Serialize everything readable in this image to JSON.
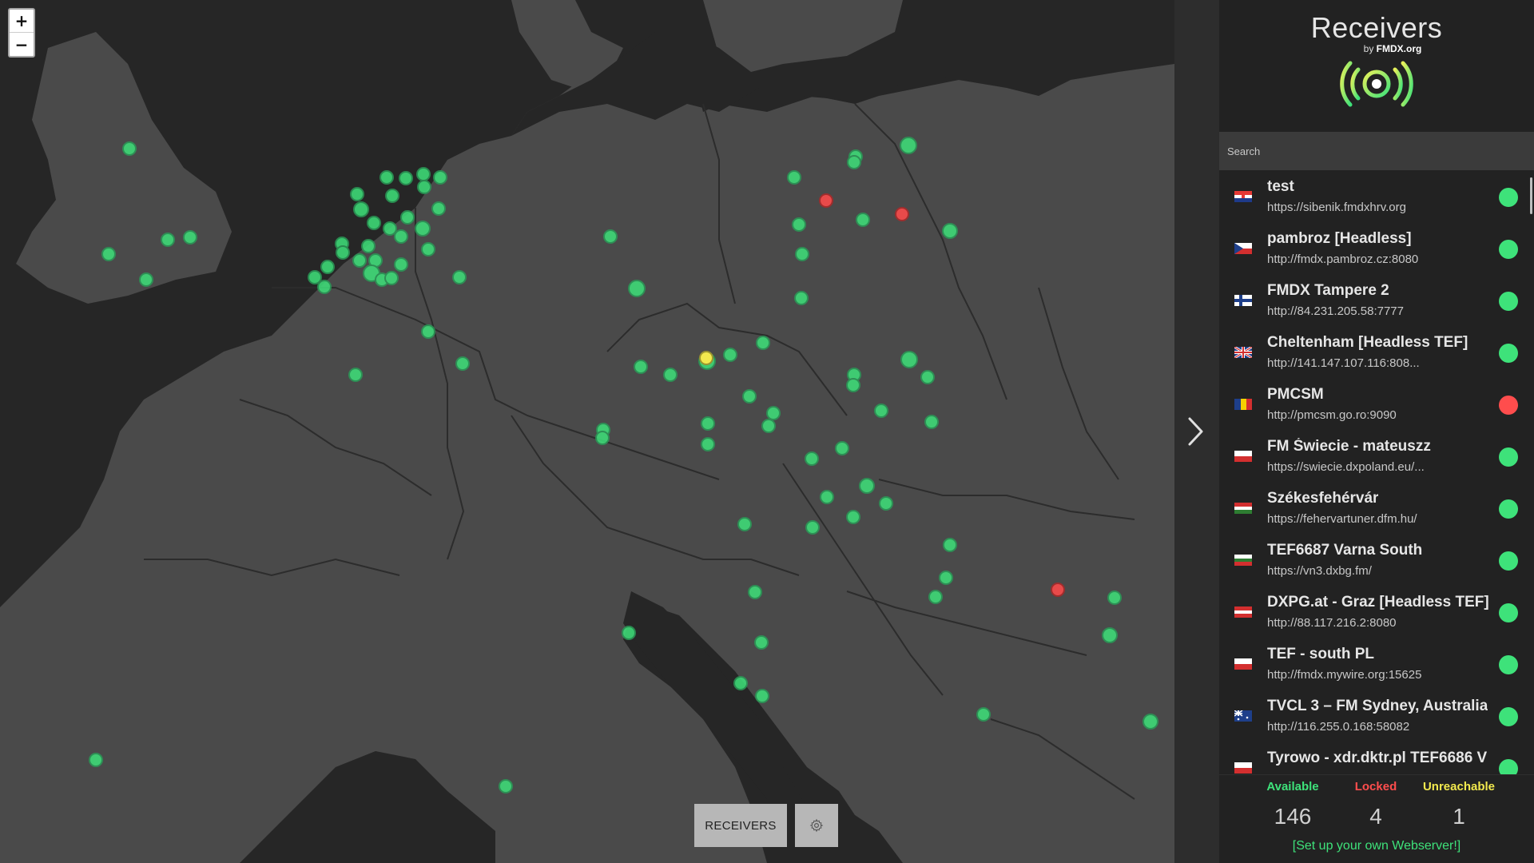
{
  "map": {
    "zoom_in_label": "+",
    "zoom_out_label": "−",
    "land_color": "#4a4a4a",
    "sea_color": "#262626",
    "border_color": "#2c2c2c",
    "marker_available_color": "#3ee27a",
    "marker_locked_color": "#e84a4a"
  },
  "bottom": {
    "receivers_label": "RECEIVERS",
    "settings_icon": "gear-icon"
  },
  "panel": {
    "title": "Receivers",
    "by_prefix": "by",
    "by_brand": "FMDX.org",
    "logo_icon": "broadcast-icon",
    "search_placeholder": "Search",
    "receivers": [
      {
        "name": "test",
        "url": "https://sibenik.fmdxhrv.org",
        "flag": "hr",
        "status": "available"
      },
      {
        "name": "pambroz [Headless]",
        "url": "http://fmdx.pambroz.cz:8080",
        "flag": "cz",
        "status": "available"
      },
      {
        "name": "FMDX Tampere 2",
        "url": "http://84.231.205.58:7777",
        "flag": "fi",
        "status": "available"
      },
      {
        "name": "Cheltenham [Headless TEF]",
        "url": "http://141.147.107.116:808...",
        "flag": "gb",
        "status": "available"
      },
      {
        "name": "PMCSM",
        "url": "http://pmcsm.go.ro:9090",
        "flag": "ro",
        "status": "locked"
      },
      {
        "name": "FM Świecie - mateuszz",
        "url": "https://swiecie.dxpoland.eu/...",
        "flag": "pl",
        "status": "available"
      },
      {
        "name": "Székesfehérvár",
        "url": "https://fehervartuner.dfm.hu/",
        "flag": "hu",
        "status": "available"
      },
      {
        "name": "TEF6687 Varna South",
        "url": "https://vn3.dxbg.fm/",
        "flag": "bg",
        "status": "available"
      },
      {
        "name": "DXPG.at - Graz [Headless TEF]",
        "url": "http://88.117.216.2:8080",
        "flag": "at",
        "status": "available"
      },
      {
        "name": "TEF - south PL",
        "url": "http://fmdx.mywire.org:15625",
        "flag": "pl",
        "status": "available"
      },
      {
        "name": "TVCL 3 – FM Sydney, Australia",
        "url": "http://116.255.0.168:58082",
        "flag": "au",
        "status": "available"
      },
      {
        "name": "Tyrowo - xdr.dktr.pl TEF6686 V",
        "url": "",
        "flag": "pl",
        "status": "available"
      }
    ],
    "stats": {
      "available_label": "Available",
      "locked_label": "Locked",
      "unreachable_label": "Unreachable",
      "available_count": "146",
      "locked_count": "4",
      "unreachable_count": "1",
      "available_color": "#3ee27a",
      "locked_color": "#ff4d4d",
      "unreachable_color": "#f2e94e"
    },
    "setup_link": "[Set up your own Webserver!]"
  }
}
